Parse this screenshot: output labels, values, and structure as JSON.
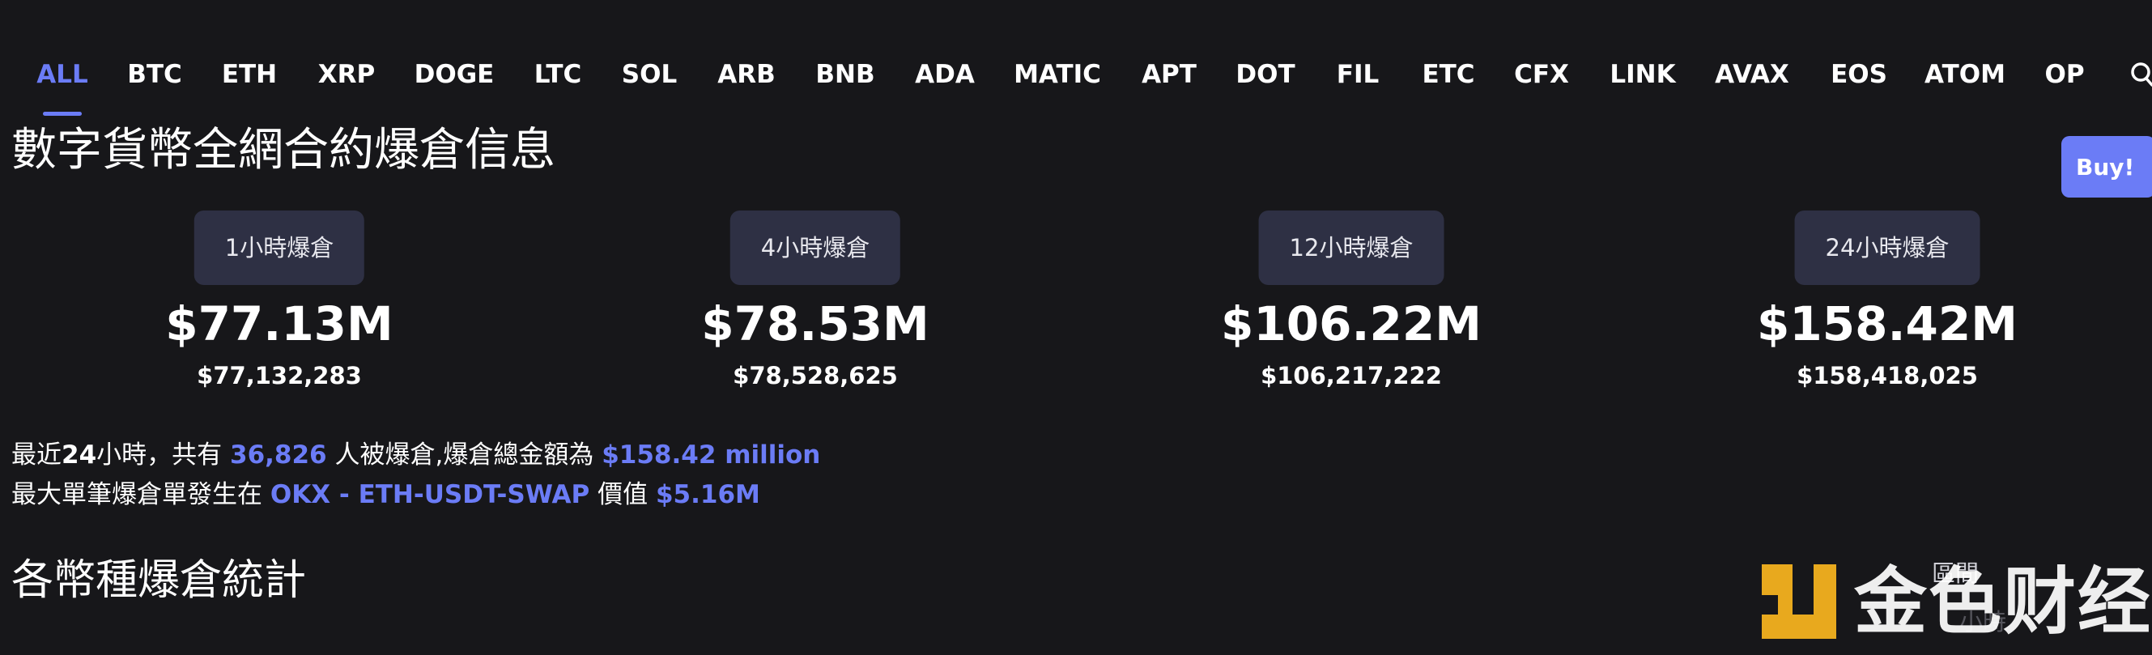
{
  "nav": {
    "items": [
      {
        "label": "ALL",
        "active": true
      },
      {
        "label": "BTC"
      },
      {
        "label": "ETH"
      },
      {
        "label": "XRP"
      },
      {
        "label": "DOGE"
      },
      {
        "label": "LTC"
      },
      {
        "label": "SOL"
      },
      {
        "label": "ARB"
      },
      {
        "label": "BNB"
      },
      {
        "label": "ADA"
      },
      {
        "label": "MATIC"
      },
      {
        "label": "APT"
      },
      {
        "label": "DOT"
      },
      {
        "label": "FIL"
      },
      {
        "label": "ETC"
      },
      {
        "label": "CFX"
      },
      {
        "label": "LINK"
      },
      {
        "label": "AVAX"
      },
      {
        "label": "EOS"
      },
      {
        "label": "ATOM"
      },
      {
        "label": "OP"
      }
    ],
    "search_icon": "search-icon"
  },
  "page_title": "數字貨幣全網合約爆倉信息",
  "buy_button": "Buy!",
  "stats": [
    {
      "tab": "1小時爆倉",
      "amount": "$77.13M",
      "exact": "$77,132,283"
    },
    {
      "tab": "4小時爆倉",
      "amount": "$78.53M",
      "exact": "$78,528,625"
    },
    {
      "tab": "12小時爆倉",
      "amount": "$106.22M",
      "exact": "$106,217,222"
    },
    {
      "tab": "24小時爆倉",
      "amount": "$158.42M",
      "exact": "$158,418,025"
    }
  ],
  "summary": {
    "line1_prefix": "最近",
    "line1_hours": "24",
    "line1_mid": "小時，共有",
    "line1_count": "36,826",
    "line1_mid2": "人被爆倉,爆倉總金額為",
    "line1_total": "$158.42 million",
    "line2_prefix": "最大單筆爆倉單發生在",
    "line2_market": "OKX - ETH-USDT-SWAP",
    "line2_mid": "價值",
    "line2_value": "$5.16M"
  },
  "section_title": "各幣種爆倉統計",
  "faded_labels": [
    "區間",
    "小時"
  ],
  "watermark": {
    "text": "金色财经",
    "logo_color": "#e8a91e"
  },
  "colors": {
    "background": "#17171a",
    "accent": "#6b7cf6",
    "tab_bg": "#2e3044"
  }
}
